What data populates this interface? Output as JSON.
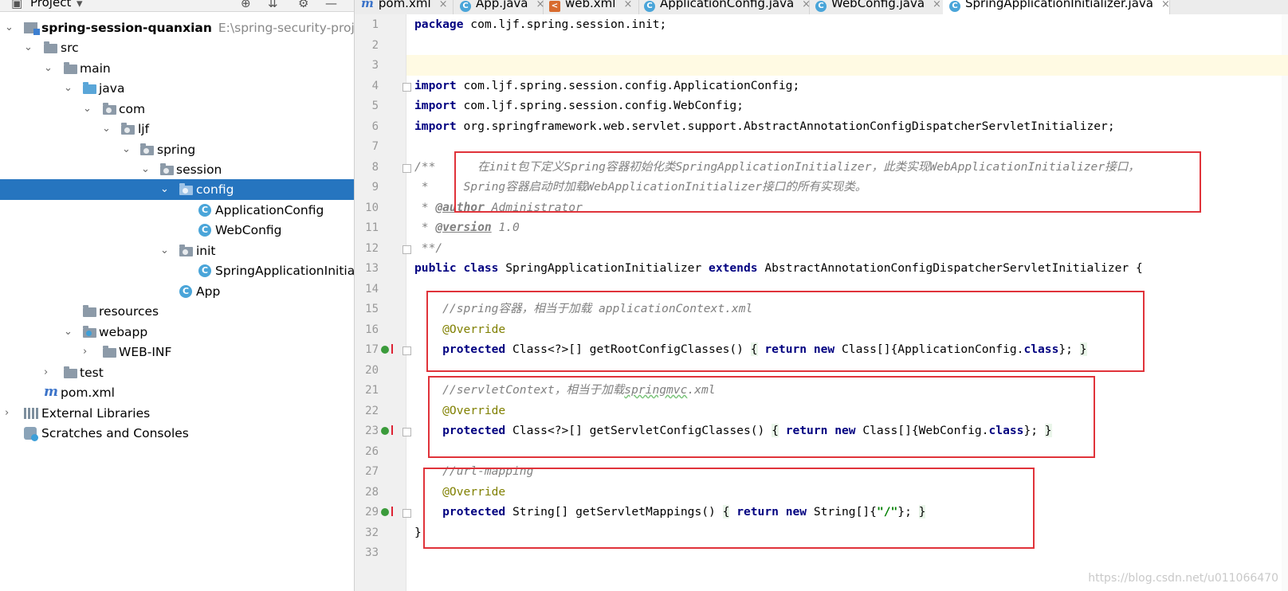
{
  "project_panel": {
    "title": "Project",
    "tree": [
      {
        "label": "spring-session-quanxian",
        "extra": "E:\\spring-security-project\\s",
        "bold": true
      },
      {
        "label": "src"
      },
      {
        "label": "main"
      },
      {
        "label": "java"
      },
      {
        "label": "com"
      },
      {
        "label": "ljf"
      },
      {
        "label": "spring"
      },
      {
        "label": "session"
      },
      {
        "label": "config"
      },
      {
        "label": "ApplicationConfig"
      },
      {
        "label": "WebConfig"
      },
      {
        "label": "init"
      },
      {
        "label": "SpringApplicationInitia"
      },
      {
        "label": "App"
      },
      {
        "label": "resources"
      },
      {
        "label": "webapp"
      },
      {
        "label": "WEB-INF"
      },
      {
        "label": "test"
      },
      {
        "label": "pom.xml"
      },
      {
        "label": "External Libraries"
      },
      {
        "label": "Scratches and Consoles"
      }
    ]
  },
  "tabs": [
    {
      "label": "pom.xml",
      "icon": "maven-icon"
    },
    {
      "label": "App.java",
      "icon": "class-icon"
    },
    {
      "label": "web.xml",
      "icon": "xml-icon"
    },
    {
      "label": "ApplicationConfig.java",
      "icon": "class-icon"
    },
    {
      "label": "WebConfig.java",
      "icon": "class-icon"
    },
    {
      "label": "SpringApplicationInitializer.java",
      "icon": "class-icon",
      "active": true
    }
  ],
  "line_numbers": [
    "1",
    "2",
    "3",
    "4",
    "5",
    "6",
    "7",
    "8",
    "9",
    "10",
    "11",
    "12",
    "13",
    "14",
    "15",
    "16",
    "17",
    "20",
    "21",
    "22",
    "23",
    "26",
    "27",
    "28",
    "29",
    "32",
    "33"
  ],
  "code": {
    "l1_kw": "package",
    "l1_rest": " com.ljf.spring.session.init;",
    "l4_kw": "import",
    "l4_rest": " com.ljf.spring.session.config.ApplicationConfig;",
    "l5_kw": "import",
    "l5_rest": " com.ljf.spring.session.config.WebConfig;",
    "l6_kw": "import",
    "l6_rest": " org.springframework.web.servlet.support.AbstractAnnotationConfigDispatcherServletInitializer;",
    "l8": "/**      在init包下定义Spring容器初始化类SpringApplicationInitializer，此类实现WebApplicationInitializer接口，",
    "l9": " *     Spring容器启动时加载WebApplicationInitializer接口的所有实现类。",
    "l10_pre": " * ",
    "l10_tag": "@author",
    "l10_post": " Administrator",
    "l11_pre": " * ",
    "l11_tag": "@version",
    "l11_post": " 1.0",
    "l12": " **/",
    "l13_kw1": "public class",
    "l13_mid": " SpringApplicationInitializer ",
    "l13_kw2": "extends",
    "l13_rest": " AbstractAnnotationConfigDispatcherServletInitializer {",
    "l15": "    //spring容器，相当于加载 applicationContext.xml",
    "l16": "    @Override",
    "l17_kw": "    protected",
    "l17_mid": " Class<?>[] getRootConfigClasses() ",
    "l17_b1": "{",
    "l17_kw2": " return new",
    "l17_mid2": " Class[]{ApplicationConfig.",
    "l17_kw3": "class",
    "l17_end": "}; ",
    "l17_b2": "}",
    "l20_a": "    //servletContext，相当于加载",
    "l20_b": "springmvc",
    "l20_c": ".xml",
    "l21": "    @Override",
    "l23_kw": "    protected",
    "l23_mid": " Class<?>[] getServletConfigClasses() ",
    "l23_b1": "{",
    "l23_kw2": " return new",
    "l23_mid2": " Class[]{WebConfig.",
    "l23_kw3": "class",
    "l23_end": "}; ",
    "l23_b2": "}",
    "l27": "    //url-mapping",
    "l28": "    @Override",
    "l29_kw": "    protected",
    "l29_mid": " String[] getServletMappings() ",
    "l29_b1": "{",
    "l29_kw2": " return new",
    "l29_mid2": " String[]{",
    "l29_str": "\"/\"",
    "l29_end": "}; ",
    "l29_b2": "}",
    "l32": "}"
  },
  "watermark": "https://blog.csdn.net/u011066470"
}
